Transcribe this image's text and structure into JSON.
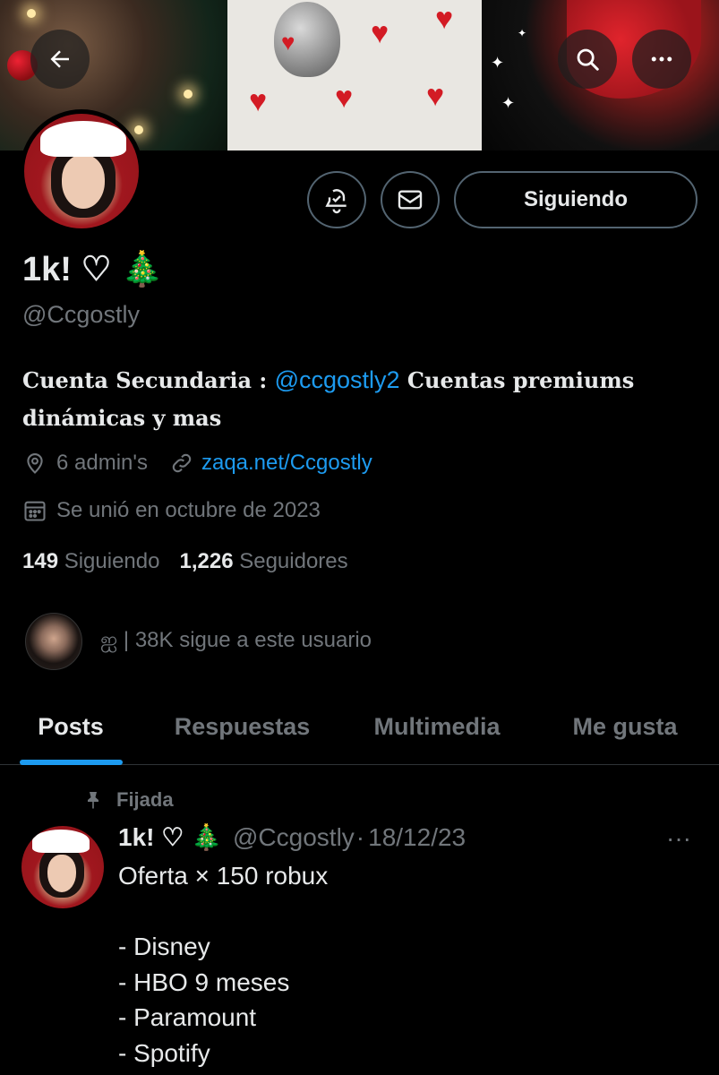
{
  "header": {
    "banner_desc": "banner-image",
    "back_icon": "arrow-left-icon",
    "search_icon": "search-icon",
    "more_icon": "more-horizontal-icon"
  },
  "profile": {
    "display_name": "1k! ♡ 🎄",
    "handle": "@Ccgostly",
    "bio_prefix": "Cuenta Secundaria : ",
    "bio_mention": "@ccgostly2",
    "bio_suffix": " Cuentas premiums dinámicas y mas",
    "location": "6 admin's",
    "website": "zaqa.net/Ccgostly",
    "joined": "Se unió en octubre de 2023",
    "following_count": "149",
    "following_label": "Siguiendo",
    "followers_count": "1,226",
    "followers_label": "Seguidores",
    "followed_by": "ஐ | 38K sigue a este usuario"
  },
  "actions": {
    "following_button": "Siguiendo"
  },
  "tabs": [
    {
      "label": "Posts",
      "active": true
    },
    {
      "label": "Respuestas",
      "active": false
    },
    {
      "label": "Multimedia",
      "active": false
    },
    {
      "label": "Me gusta",
      "active": false
    }
  ],
  "post": {
    "pinned_label": "Fijada",
    "author_name": "1k! ♡ 🎄",
    "author_handle": "@Ccgostly",
    "separator": "·",
    "date": "18/12/23",
    "more": "···",
    "text": "Oferta × 150 robux\n\n- Disney\n- HBO 9 meses\n- Paramount\n- Spotify"
  },
  "colors": {
    "background": "#000000",
    "text_primary": "#e7e9ea",
    "text_secondary": "#71767b",
    "accent": "#1d9bf0",
    "border": "#536471"
  }
}
